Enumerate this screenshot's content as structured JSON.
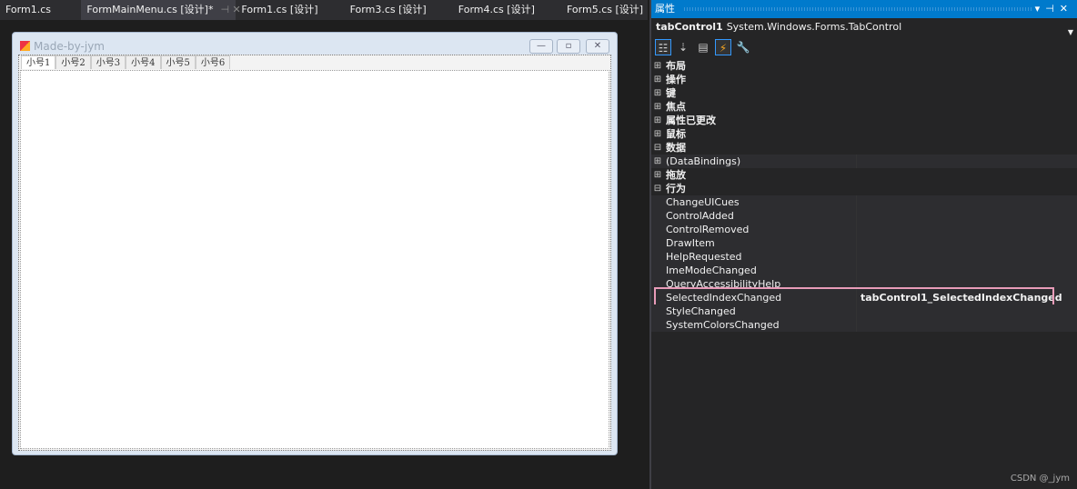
{
  "doc_tabs": [
    {
      "label": "Form1.cs",
      "active": false
    },
    {
      "label": "FormMainMenu.cs [设计]*",
      "active": true
    },
    {
      "label": "Form1.cs [设计]",
      "active": false
    },
    {
      "label": "Form3.cs [设计]",
      "active": false
    },
    {
      "label": "Form4.cs [设计]",
      "active": false
    },
    {
      "label": "Form5.cs [设计]",
      "active": false
    }
  ],
  "form": {
    "title": "Made-by-jym",
    "tabs": [
      "小号1",
      "小号2",
      "小号3",
      "小号4",
      "小号5",
      "小号6"
    ]
  },
  "properties": {
    "title": "属性",
    "object_name": "tabControl1",
    "object_type": "System.Windows.Forms.TabControl",
    "rows": [
      {
        "kind": "cat",
        "exp": "⊞",
        "name": "布局"
      },
      {
        "kind": "cat",
        "exp": "⊞",
        "name": "操作"
      },
      {
        "kind": "cat",
        "exp": "⊞",
        "name": "键"
      },
      {
        "kind": "cat",
        "exp": "⊞",
        "name": "焦点"
      },
      {
        "kind": "cat",
        "exp": "⊞",
        "name": "属性已更改"
      },
      {
        "kind": "cat",
        "exp": "⊞",
        "name": "鼠标"
      },
      {
        "kind": "cat",
        "exp": "⊟",
        "name": "数据"
      },
      {
        "kind": "prop",
        "exp": "⊞",
        "name": "(DataBindings)"
      },
      {
        "kind": "cat",
        "exp": "⊞",
        "name": "拖放"
      },
      {
        "kind": "cat",
        "exp": "⊟",
        "name": "行为"
      },
      {
        "kind": "prop",
        "name": "ChangeUICues"
      },
      {
        "kind": "prop",
        "name": "ControlAdded"
      },
      {
        "kind": "prop",
        "name": "ControlRemoved"
      },
      {
        "kind": "prop",
        "name": "DrawItem"
      },
      {
        "kind": "prop",
        "name": "HelpRequested"
      },
      {
        "kind": "prop",
        "name": "ImeModeChanged"
      },
      {
        "kind": "prop",
        "name": "QueryAccessibilityHelp"
      },
      {
        "kind": "prop",
        "name": "SelectedIndexChanged",
        "value": "tabControl1_SelectedIndexChanged",
        "highlight": true
      },
      {
        "kind": "prop",
        "name": "StyleChanged"
      },
      {
        "kind": "prop",
        "name": "SystemColorsChanged"
      }
    ]
  },
  "watermark": "CSDN @_jym",
  "colors": {
    "accent": "#007acc",
    "highlight": "#e89bb8"
  }
}
